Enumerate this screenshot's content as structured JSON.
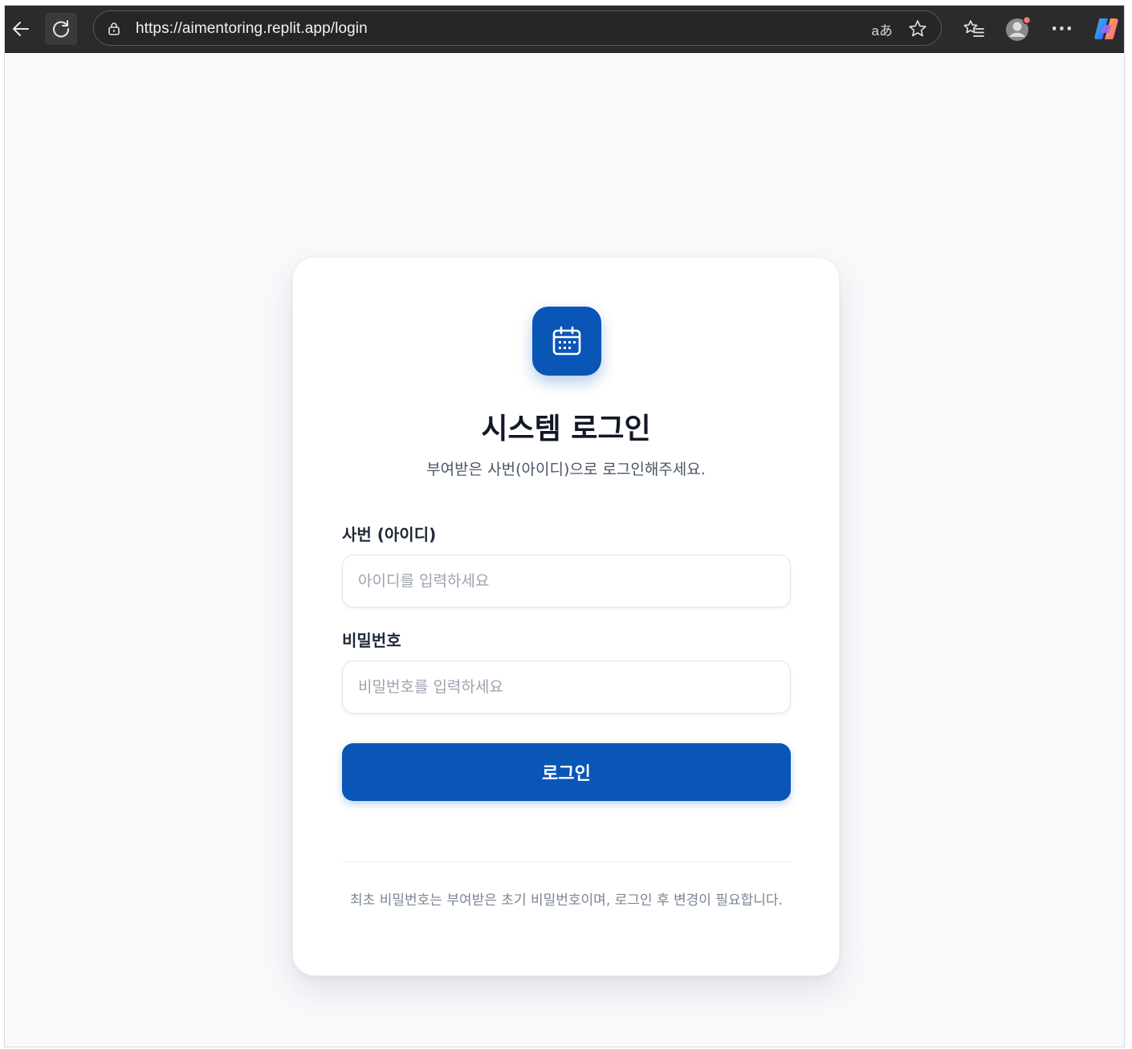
{
  "browser": {
    "url": "https://aimentoring.replit.app/login",
    "read_aloud_label": "aあ"
  },
  "icons": {
    "back": "back-arrow-icon",
    "reload": "reload-icon",
    "lock": "site-info-icon",
    "read_aloud": "read-aloud-icon",
    "favorite": "star-icon",
    "favorites": "favorites-icon",
    "profile": "profile-avatar-icon",
    "more": "more-icon",
    "copilot": "copilot-icon",
    "logo": "calendar-icon"
  },
  "colors": {
    "primary": "#0a56b7",
    "page_background": "#f8f9fb",
    "browser_bar": "#2b2b2b"
  },
  "login": {
    "title": "시스템 로그인",
    "subtitle": "부여받은 사번(아이디)으로 로그인해주세요.",
    "id_label": "사번 (아이디)",
    "id_placeholder": "아이디를 입력하세요",
    "id_value": "",
    "password_label": "비밀번호",
    "password_placeholder": "비밀번호를 입력하세요",
    "password_value": "",
    "button_label": "로그인",
    "footnote": "최초 비밀번호는 부여받은 초기 비밀번호이며, 로그인 후 변경이 필요합니다."
  },
  "toolbar": {
    "more_label": "···"
  }
}
